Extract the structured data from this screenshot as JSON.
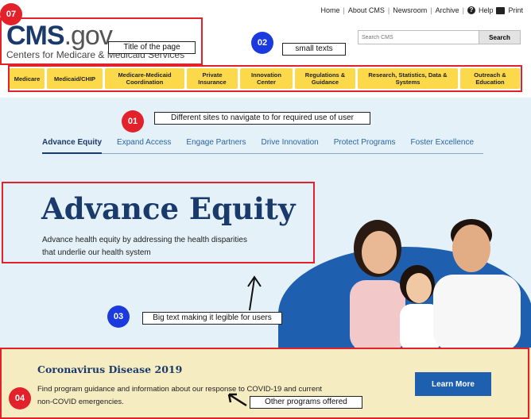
{
  "utility": {
    "home": "Home",
    "about": "About CMS",
    "newsroom": "Newsroom",
    "archive": "Archive",
    "help": "Help",
    "print": "Print",
    "help_icon": "?"
  },
  "logo": {
    "main": "CMS",
    "gov": ".gov",
    "sub": "Centers for Medicare & Medicaid Services"
  },
  "search": {
    "placeholder": "Search CMS",
    "button": "Search"
  },
  "nav": [
    "Medicare",
    "Medicaid/CHIP",
    "Medicare-Medicaid Coordination",
    "Private Insurance",
    "Innovation Center",
    "Regulations & Guidance",
    "Research, Statistics, Data & Systems",
    "Outreach & Education"
  ],
  "tabs": [
    "Advance Equity",
    "Expand Access",
    "Engage Partners",
    "Drive Innovation",
    "Protect Programs",
    "Foster Excellence"
  ],
  "hero": {
    "title": "Advance Equity",
    "desc": "Advance health equity by addressing the health disparities that underlie our health system"
  },
  "covid": {
    "title": "Coronavirus Disease 2019",
    "desc": "Find program guidance and information about our response to COVID-19 and current non-COVID emergencies.",
    "button": "Learn More"
  },
  "annotations": {
    "m07": "07",
    "m02": "02",
    "m01": "01",
    "m03": "03",
    "m04": "04",
    "title_note": "Title of the page",
    "small_note": "small texts",
    "nav_note": "Different sites to navigate to for required use of user",
    "big_note": "Big text making it legible for users",
    "other_note": "Other programs offered"
  },
  "colors": {
    "brand": "#1a3a6b",
    "nav": "#fcd94b",
    "annotation_red": "#e3212b",
    "annotation_blue": "#1a3ae0",
    "button": "#1f5fb0"
  }
}
